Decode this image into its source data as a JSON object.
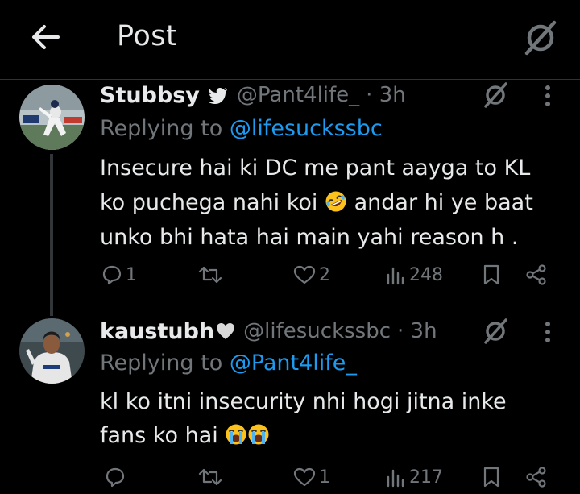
{
  "header": {
    "title": "Post"
  },
  "posts": [
    {
      "name": "Stubbsy",
      "handle": "@Pant4life_",
      "time": "· 3h",
      "replying_prefix": "Replying to ",
      "replying_handle": "@lifesuckssbc",
      "lines": [
        "Insecure hai ki DC me pant aayga to KL",
        "ko puchega nahi koi",
        "andar hi ye baat",
        "unko bhi hata hai main yahi reason h ."
      ],
      "actions": {
        "replies": "1",
        "reposts": "",
        "likes": "2",
        "views": "248"
      }
    },
    {
      "name": "kaustubh",
      "handle": "@lifesuckssbc",
      "time": "· 3h",
      "replying_prefix": "Replying to ",
      "replying_handle": "@Pant4life_",
      "lines": [
        "kl ko itni insecurity nhi hogi jitna inke",
        "fans ko hai"
      ],
      "actions": {
        "replies": "",
        "reposts": "",
        "likes": "1",
        "views": "217"
      }
    }
  ],
  "colors": {
    "background": "#000000",
    "text": "#e7e9ea",
    "muted": "#71767b",
    "link": "#1d9bf0",
    "divider": "#2f3336"
  },
  "icons": [
    "back-arrow-icon",
    "grok-icon",
    "verified-bird-icon",
    "more-icon",
    "reply-icon",
    "repost-icon",
    "like-icon",
    "views-icon",
    "bookmark-icon",
    "share-icon",
    "rofl-emoji",
    "crying-emoji",
    "white-heart-emoji"
  ]
}
